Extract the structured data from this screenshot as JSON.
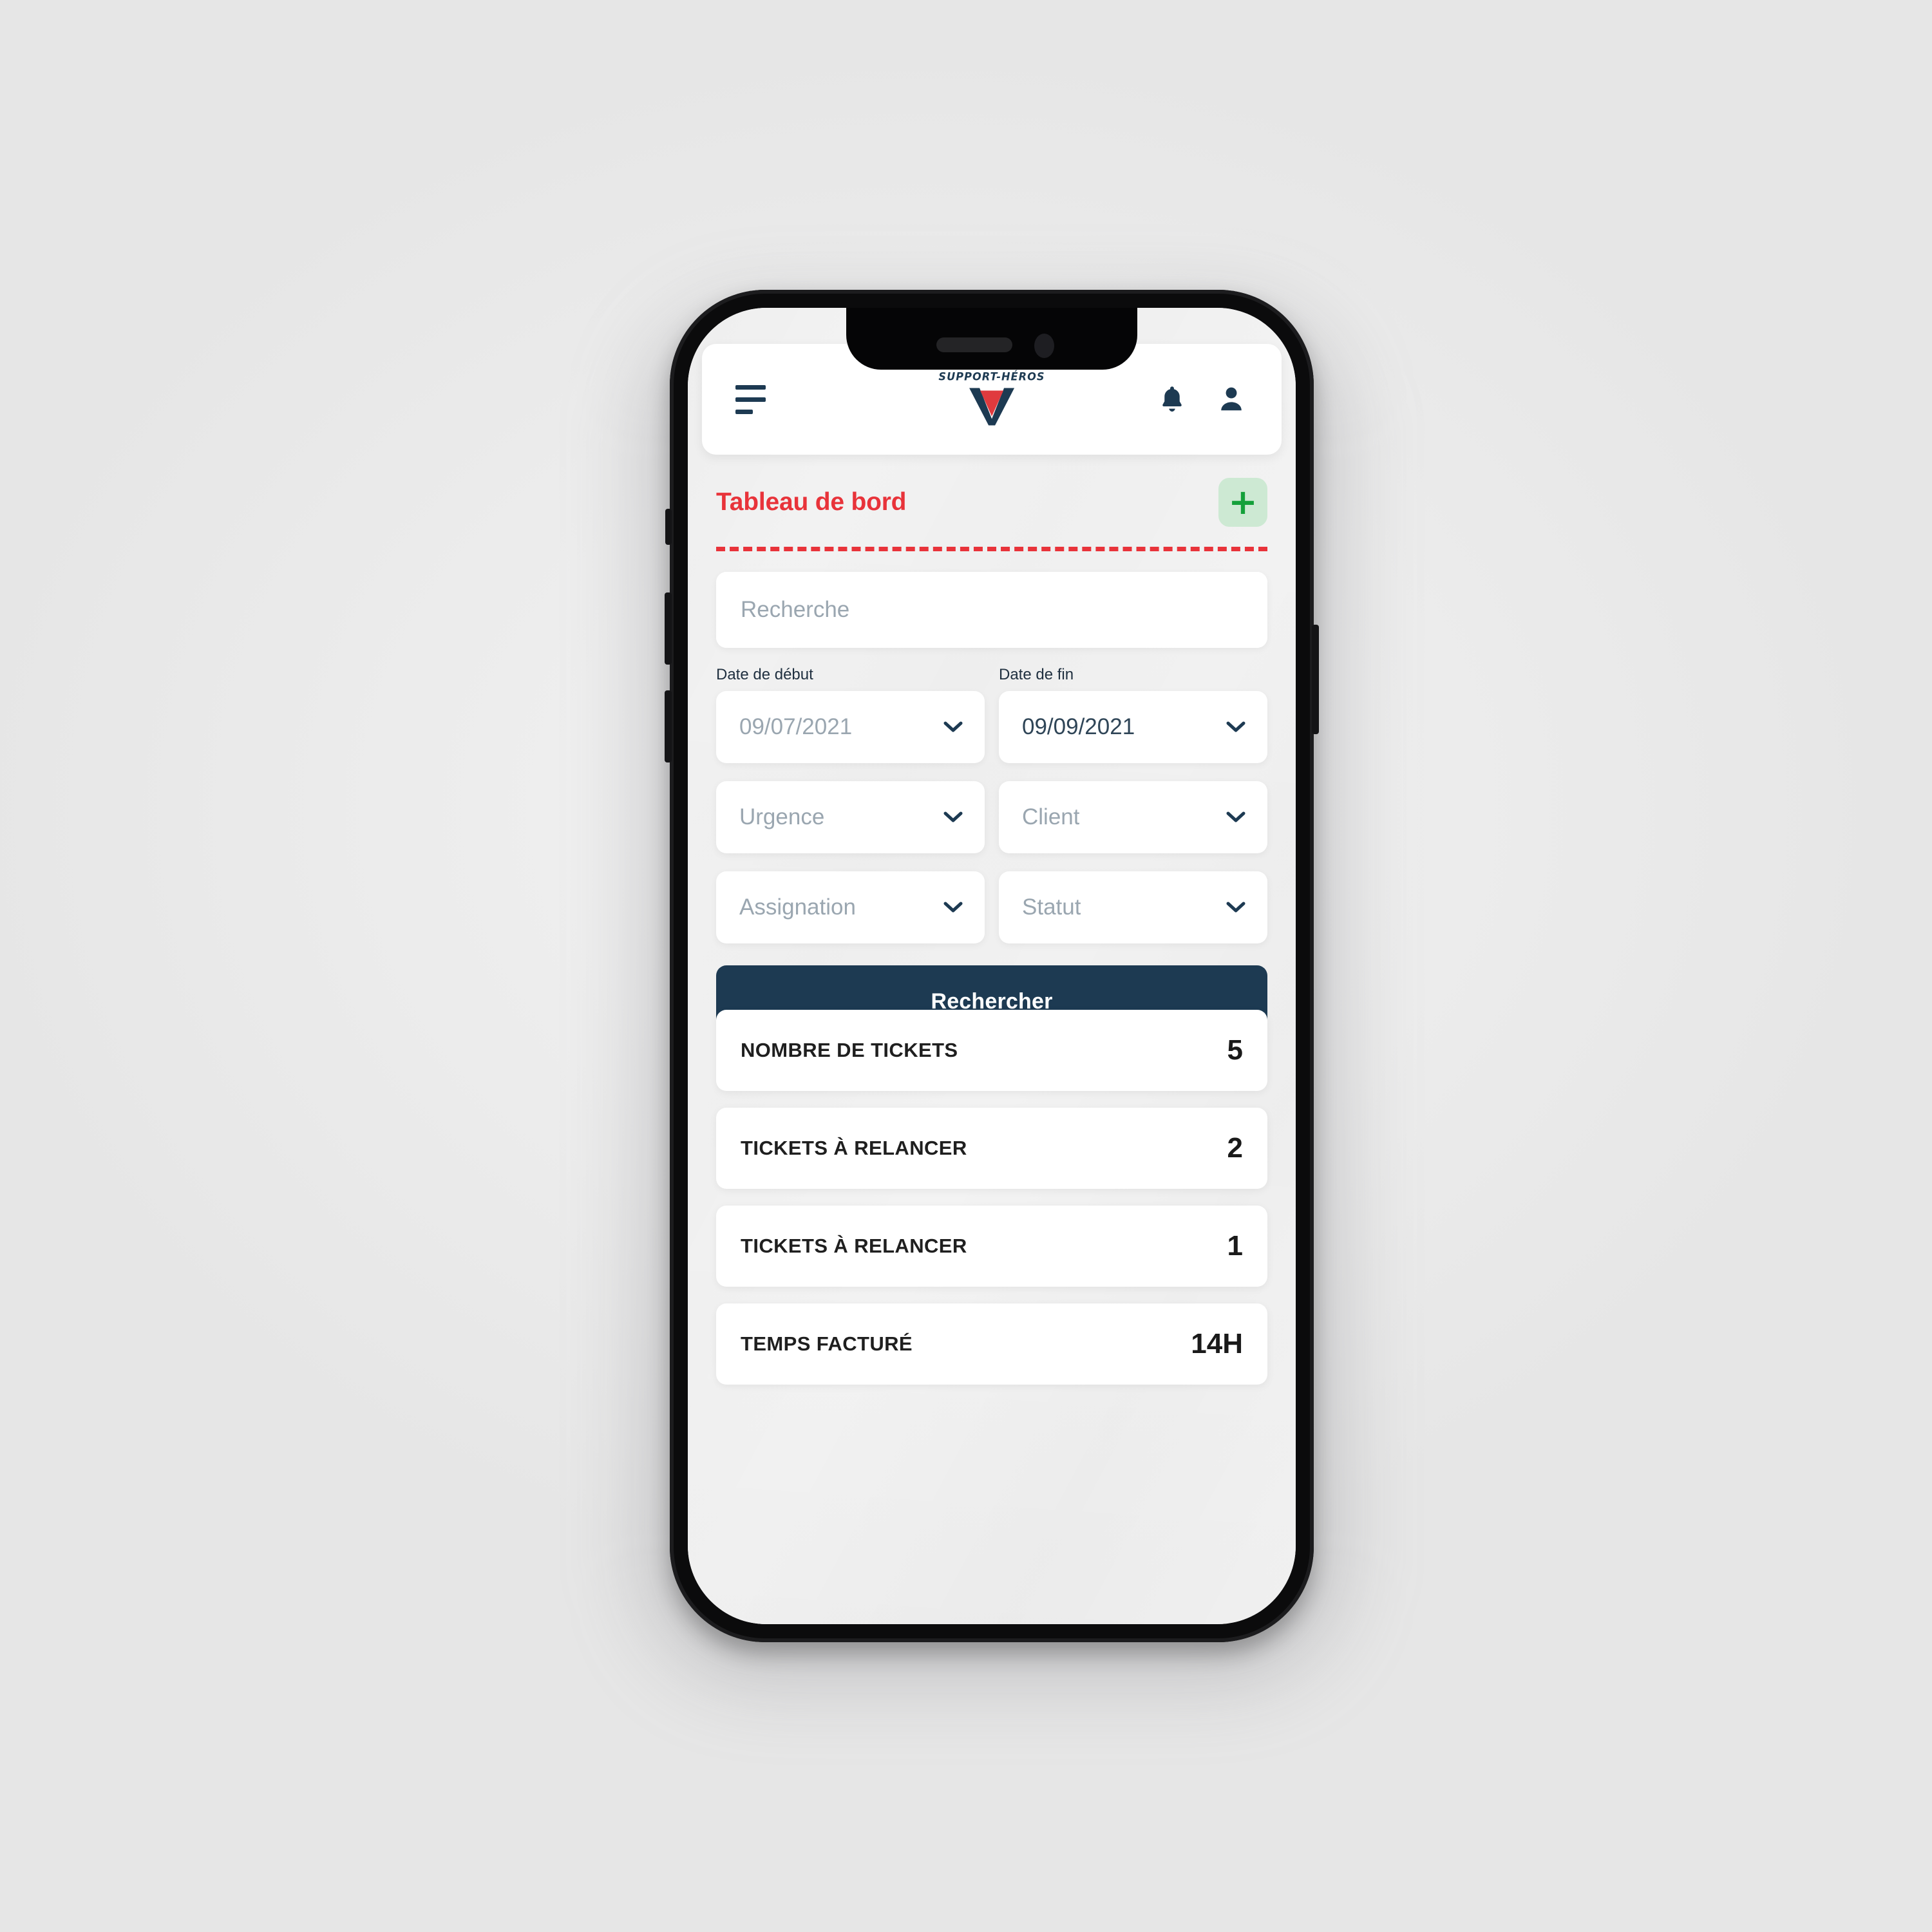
{
  "brand": {
    "wordmark": "SUPPORT-HÉROS",
    "logo_triangle_color": "#e03a3e",
    "logo_chevron_color": "#1d3a52"
  },
  "header": {
    "menu_icon": "hamburger-icon",
    "notifications_icon": "bell-icon",
    "account_icon": "user-icon"
  },
  "page": {
    "title": "Tableau de bord",
    "title_color": "#e8333a",
    "add_button_label": "+",
    "add_button_bg": "#cde9d3",
    "add_button_fg": "#14a03a"
  },
  "filters": {
    "search": {
      "placeholder": "Recherche",
      "value": ""
    },
    "date_start": {
      "label": "Date de début",
      "value": "09/07/2021",
      "filled": false
    },
    "date_end": {
      "label": "Date de fin",
      "value": "09/09/2021",
      "filled": true
    },
    "urgence": {
      "placeholder": "Urgence",
      "value": "Urgence"
    },
    "client": {
      "placeholder": "Client",
      "value": "Client"
    },
    "assignation": {
      "placeholder": "Assignation",
      "value": "Assignation"
    },
    "statut": {
      "placeholder": "Statut",
      "value": "Statut"
    },
    "submit_label": "Rechercher",
    "submit_bg": "#1d3a52"
  },
  "stats": [
    {
      "label": "NOMBRE DE TICKETS",
      "value": "5"
    },
    {
      "label": "TICKETS À RELANCER",
      "value": "2"
    },
    {
      "label": "TICKETS À RELANCER",
      "value": "1"
    },
    {
      "label": "TEMPS FACTURÉ",
      "value": "14H"
    }
  ]
}
